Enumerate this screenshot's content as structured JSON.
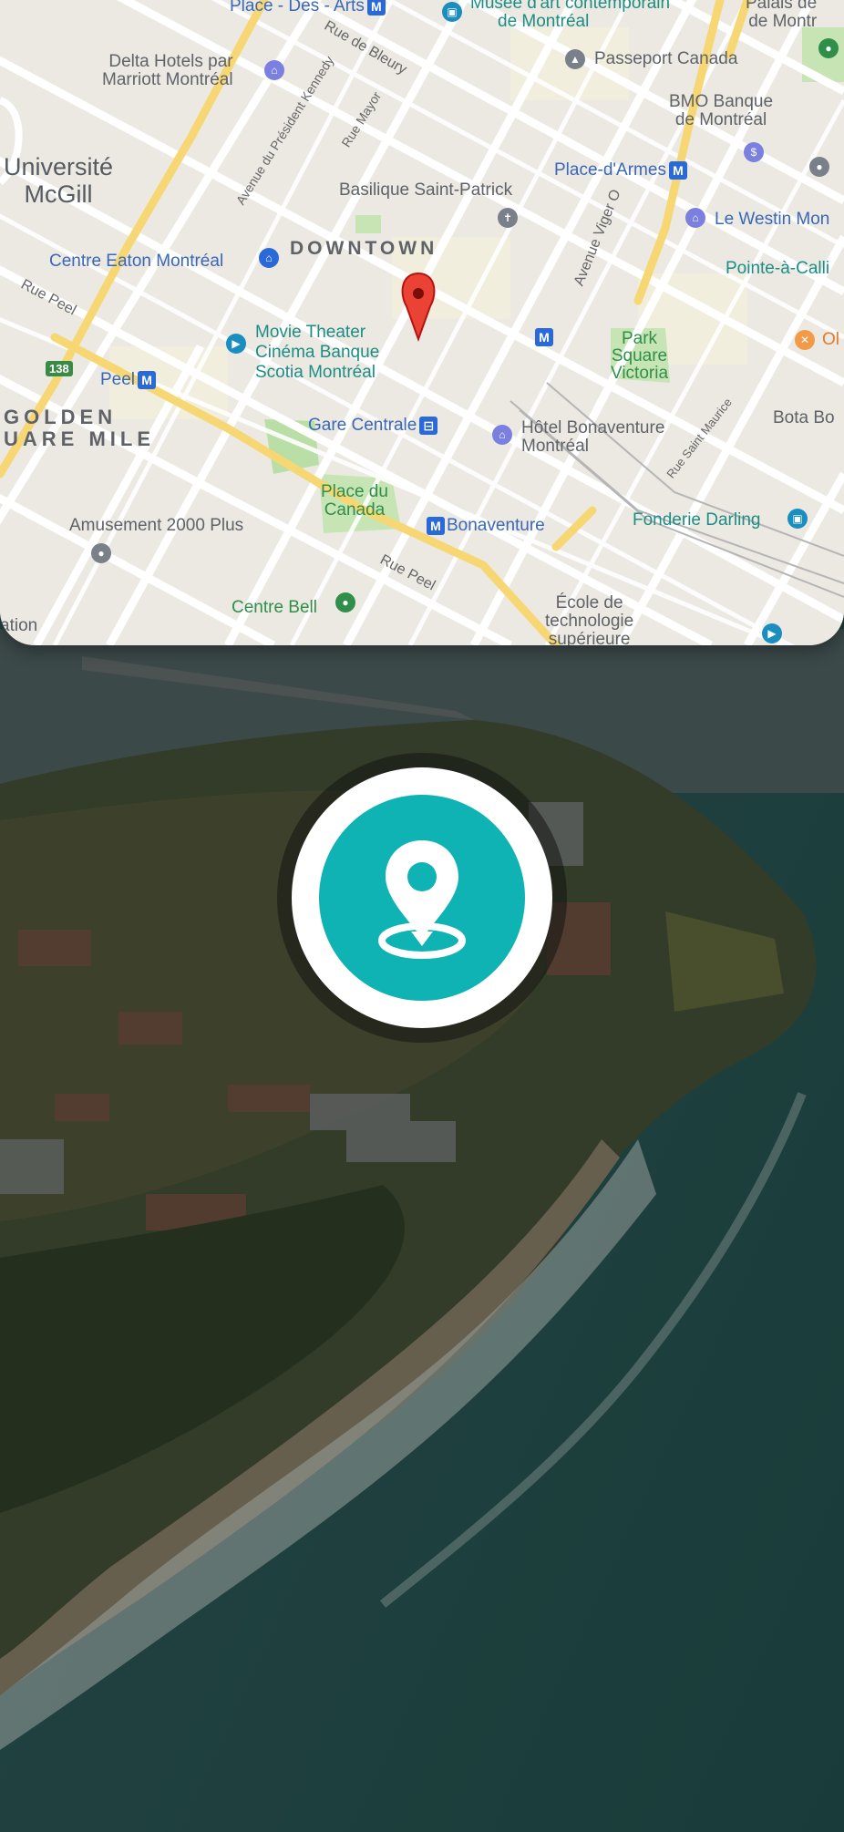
{
  "map": {
    "labels": {
      "place_des_arts": "Place - Des - Arts",
      "musee_1": "Musée d'art contemporain",
      "musee_2": "de Montréal",
      "palais_1": "Palais de",
      "palais_2": "de Montr",
      "delta_1": "Delta Hotels par",
      "delta_2": "Marriott Montréal",
      "rue_bleury": "Rue de Bleury",
      "passeport": "Passeport Canada",
      "bmo_1": "BMO Banque",
      "bmo_2": "de Montréal",
      "mcgill_1": "Université",
      "mcgill_2": "McGill",
      "ave_kennedy": "Avenue du Président Kennedy",
      "rue_mayor": "Rue Mayor",
      "basilique": "Basilique Saint-Patrick",
      "place_armes": "Place-d'Armes",
      "westin": "Le Westin Mon",
      "ave_viger": "Avenue Viger O",
      "eaton": "Centre Eaton Montréal",
      "downtown": "DOWNTOWN",
      "pointe": "Pointe-à-Calli",
      "rue_peel_1": "Rue Peel",
      "movie_1": "Movie Theater",
      "movie_2": "Cinéma Banque",
      "movie_3": "Scotia Montréal",
      "parc_1": "Park",
      "parc_2": "Square",
      "parc_3": "Victoria",
      "ol": "Ol",
      "route_138": "138",
      "peel": "Peel",
      "golden_1": "GOLDEN",
      "golden_2": "UARE MILE",
      "gare": "Gare Centrale",
      "bonaventure_hotel_1": "Hôtel Bonaventure",
      "bonaventure_hotel_2": "Montréal",
      "bota": "Bota Bo",
      "rue_st_maurice": "Rue Saint Maurice",
      "place_canada_1": "Place du",
      "place_canada_2": "Canada",
      "amusement": "Amusement 2000 Plus",
      "bonaventure": "Bonaventure",
      "fonderie": "Fonderie Darling",
      "rue_peel_2": "Rue Peel",
      "centre_bell": "Centre Bell",
      "ecole_1": "École de",
      "ecole_2": "technologie",
      "ecole_3": "supérieure",
      "station": "ation",
      "metro_symbol": "M"
    },
    "pin_color": "#ea4335"
  },
  "location_button": {
    "icon": "location-pin-icon",
    "color": "#10b3b4"
  }
}
